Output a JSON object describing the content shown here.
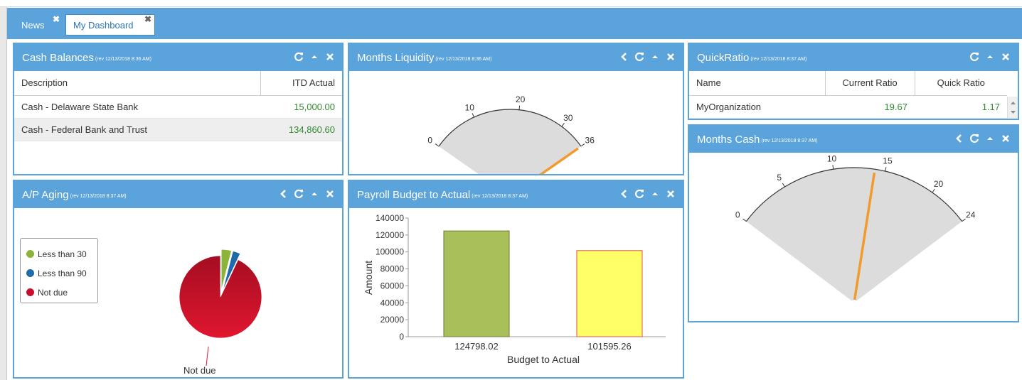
{
  "tabs": {
    "news": "News",
    "dashboard": "My Dashboard",
    "close_glyph": "✖"
  },
  "cash_balances": {
    "title": "Cash Balances",
    "rev": "(rev 12/13/2018 8:36 AM)",
    "headers": [
      "Description",
      "ITD Actual"
    ],
    "rows": [
      {
        "description": "Cash - Delaware State Bank",
        "amount": "15,000.00"
      },
      {
        "description": "Cash - Federal Bank and Trust",
        "amount": "134,860.60"
      }
    ]
  },
  "months_liquidity": {
    "title": "Months Liquidity",
    "rev": "(rev 12/13/2018 8:36 AM)",
    "ticks": [
      "0",
      "10",
      "20",
      "30",
      "36"
    ],
    "min": 0,
    "max": 36,
    "value": 36
  },
  "quick_ratio": {
    "title": "QuickRatio",
    "rev": "(rev 12/13/2018 8:37 AM)",
    "headers": [
      "Name",
      "Current Ratio",
      "Quick Ratio"
    ],
    "row": {
      "name": "MyOrganization",
      "current": "19.67",
      "quick": "1.17"
    }
  },
  "ap_aging": {
    "title": "A/P Aging",
    "rev": "(rev 12/13/2018 8:37 AM)",
    "legend": [
      "Less than 30",
      "Less than 90",
      "Not due"
    ],
    "slice_label": "Not due",
    "colors": {
      "less30": "#8db43a",
      "less90": "#1f6aa8",
      "notdue": "#c8102e"
    }
  },
  "payroll": {
    "title": "Payroll Budget to Actual",
    "rev": "(rev 12/13/2018 8:37 AM)"
  },
  "months_cash": {
    "title": "Months Cash",
    "rev": "(rev 12/13/2018 8:37 AM)",
    "ticks": [
      "0",
      "5",
      "10",
      "15",
      "20",
      "24"
    ],
    "min": 0,
    "max": 24,
    "value": 14
  },
  "chart_data": [
    {
      "type": "bar",
      "categories": [
        "124798.02",
        "101595.26"
      ],
      "values": [
        124798.02,
        101595.26
      ],
      "colors": [
        "#a9bf5a",
        "#ffff66"
      ],
      "xlabel": "Budget to Actual",
      "ylabel": "Amount",
      "ylim": [
        0,
        140000
      ],
      "yticks": [
        "140000",
        "120000",
        "100000",
        "80000",
        "60000",
        "40000",
        "20000",
        "0"
      ]
    },
    {
      "type": "pie",
      "categories": [
        "Less than 30",
        "Less than 90",
        "Not due"
      ],
      "values": [
        0.04,
        0.03,
        0.93
      ]
    }
  ]
}
